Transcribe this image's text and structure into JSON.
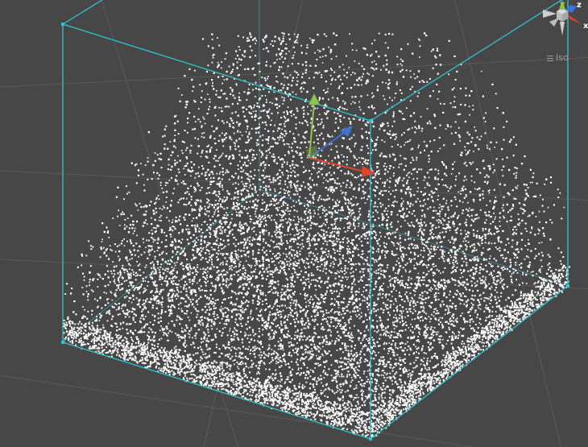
{
  "scene_view": {
    "colors": {
      "background": "#474747",
      "grid": "#5a5a5a",
      "bounds": "#2ec5d0",
      "particles": "#ffffff",
      "axis_x": "#e0452c",
      "axis_y": "#8ec34a",
      "axis_z": "#3b73d8"
    },
    "particle_count": 9000,
    "shape_rows": 90,
    "shape_cols": 90
  },
  "gizmo": {
    "x_label": "x",
    "y_label": "y",
    "z_label": "z"
  },
  "projection": {
    "label": "Iso",
    "icon": "menu-icon"
  }
}
